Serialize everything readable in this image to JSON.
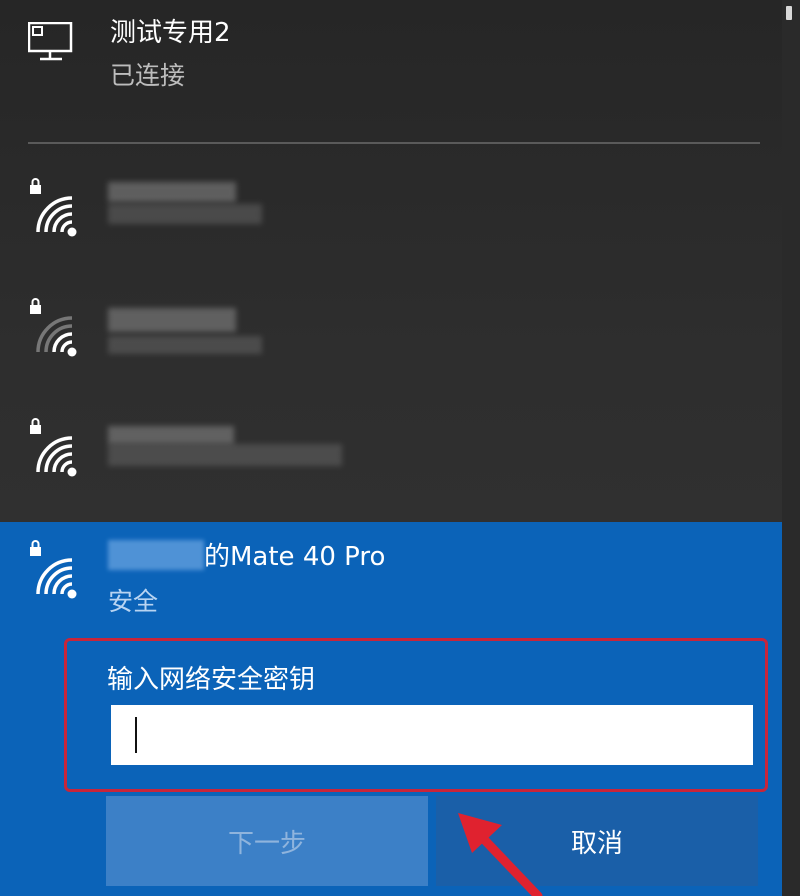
{
  "connected_network": {
    "name": "测试专用2",
    "status": "已连接",
    "icon": "desktop-computer-icon"
  },
  "networks": [
    {
      "secured": true,
      "icon": "wifi-secure-icon",
      "name_obscured": true
    },
    {
      "secured": true,
      "icon": "wifi-secure-icon",
      "name_obscured": true
    },
    {
      "secured": true,
      "icon": "wifi-secure-icon",
      "name_obscured": true
    }
  ],
  "selected_network": {
    "name": "的Mate 40 Pro",
    "security": "安全",
    "icon": "wifi-secure-icon"
  },
  "key_form": {
    "label": "输入网络安全密钥",
    "value": "",
    "placeholder": ""
  },
  "buttons": {
    "next": "下一步",
    "cancel": "取消"
  },
  "colors": {
    "selected_bg": "#0b63b8",
    "highlight_border": "#c8253a",
    "annotation_arrow": "#e0222f"
  }
}
